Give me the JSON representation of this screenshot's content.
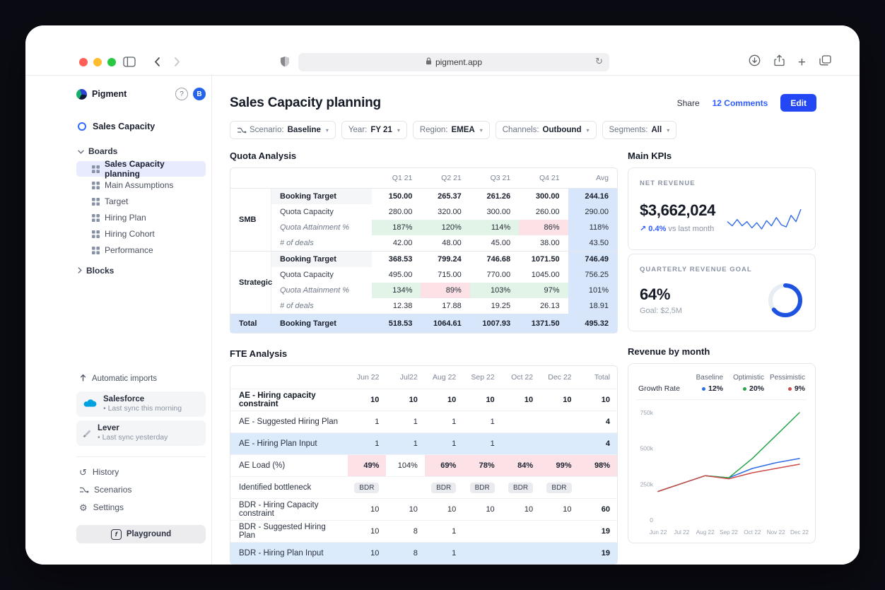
{
  "browser": {
    "address": "pigment.app"
  },
  "icons": {
    "back": "‹",
    "forward": "›",
    "reload": "↻",
    "new_tab": "+",
    "help": "?",
    "trend_up": "↗",
    "chevron_down": "▾",
    "history": "↺",
    "settings": "⚙",
    "bullet": "•",
    "playground": "f"
  },
  "theme": {
    "accent_blue": "#2447f5",
    "link_blue": "#2e5bff",
    "positive_cell": "#e2f3e7",
    "negative_cell": "#fce2e6",
    "avg_highlight": "#d8e6fb",
    "row_highlight": "#dcebfc",
    "selected_item_bg": "#e7ebfd",
    "sparkline_blue": "#2f6be6",
    "donut_blue": "#1d53e0"
  },
  "sidebar": {
    "app_name": "Pigment",
    "avatar_initial": "B",
    "workspace": {
      "label": "Sales Capacity"
    },
    "boards_section": "Boards",
    "boards": [
      {
        "label": "Sales Capacity planning",
        "selected": true
      },
      {
        "label": "Main Assumptions"
      },
      {
        "label": "Target"
      },
      {
        "label": "Hiring Plan"
      },
      {
        "label": "Hiring Cohort"
      },
      {
        "label": "Performance"
      }
    ],
    "blocks_section": "Blocks",
    "automatic_imports": "Automatic imports",
    "integrations": [
      {
        "name": "Salesforce",
        "status": "Last sync this morning",
        "icon": "salesforce-logo"
      },
      {
        "name": "Lever",
        "status": "Last sync yesterday",
        "icon": "lever-logo"
      }
    ],
    "menu": [
      {
        "label": "History",
        "icon": "history-icon"
      },
      {
        "label": "Scenarios",
        "icon": "scenario-icon"
      },
      {
        "label": "Settings",
        "icon": "settings-icon"
      }
    ],
    "playground_label": "Playground"
  },
  "header": {
    "title": "Sales Capacity planning",
    "share_label": "Share",
    "comments_label": "12 Comments",
    "edit_label": "Edit"
  },
  "filters": [
    {
      "label": "Scenario:",
      "value": "Baseline",
      "icon": "scenario"
    },
    {
      "label": "Year:",
      "value": "FY 21"
    },
    {
      "label": "Region:",
      "value": "EMEA"
    },
    {
      "label": "Channels:",
      "value": "Outbound"
    },
    {
      "label": "Segments:",
      "value": "All"
    }
  ],
  "quota_analysis": {
    "title": "Quota Analysis",
    "columns": [
      "Q1 21",
      "Q2 21",
      "Q3 21",
      "Q4 21",
      "Avg"
    ],
    "groups": [
      {
        "name": "SMB",
        "rows": [
          {
            "label": "Booking Target",
            "style": "bold",
            "cells": [
              {
                "v": "150.00"
              },
              {
                "v": "265.37"
              },
              {
                "v": "261.26"
              },
              {
                "v": "300.00"
              },
              {
                "v": "244.16",
                "bg": "blue"
              }
            ]
          },
          {
            "label": "Quota Capacity",
            "cells": [
              {
                "v": "280.00"
              },
              {
                "v": "320.00"
              },
              {
                "v": "300.00"
              },
              {
                "v": "260.00"
              },
              {
                "v": "290.00",
                "bg": "blue"
              }
            ]
          },
          {
            "label": "Quota Attainment %",
            "style": "italic",
            "cells": [
              {
                "v": "187%",
                "bg": "green"
              },
              {
                "v": "120%",
                "bg": "green"
              },
              {
                "v": "114%",
                "bg": "green"
              },
              {
                "v": "86%",
                "bg": "red"
              },
              {
                "v": "118%",
                "bg": "blue"
              }
            ]
          },
          {
            "label": "# of deals",
            "style": "italic",
            "cells": [
              {
                "v": "42.00"
              },
              {
                "v": "48.00"
              },
              {
                "v": "45.00"
              },
              {
                "v": "38.00"
              },
              {
                "v": "43.50",
                "bg": "blue"
              }
            ]
          }
        ]
      },
      {
        "name": "Strategic",
        "rows": [
          {
            "label": "Booking Target",
            "style": "bold",
            "cells": [
              {
                "v": "368.53"
              },
              {
                "v": "799.24"
              },
              {
                "v": "746.68"
              },
              {
                "v": "1071.50"
              },
              {
                "v": "746.49",
                "bg": "blue"
              }
            ]
          },
          {
            "label": "Quota Capacity",
            "cells": [
              {
                "v": "495.00"
              },
              {
                "v": "715.00"
              },
              {
                "v": "770.00"
              },
              {
                "v": "1045.00"
              },
              {
                "v": "756.25",
                "bg": "blue"
              }
            ]
          },
          {
            "label": "Quota Attainment %",
            "style": "italic",
            "cells": [
              {
                "v": "134%",
                "bg": "green"
              },
              {
                "v": "89%",
                "bg": "red"
              },
              {
                "v": "103%",
                "bg": "green"
              },
              {
                "v": "97%",
                "bg": "green"
              },
              {
                "v": "101%",
                "bg": "blue"
              }
            ]
          },
          {
            "label": "# of deals",
            "style": "italic",
            "cells": [
              {
                "v": "12.38"
              },
              {
                "v": "17.88"
              },
              {
                "v": "19.25"
              },
              {
                "v": "26.13"
              },
              {
                "v": "18.91",
                "bg": "blue"
              }
            ]
          }
        ]
      }
    ],
    "total_row": {
      "name": "Total",
      "label": "Booking Target",
      "cells": [
        {
          "v": "518.53"
        },
        {
          "v": "1064.61"
        },
        {
          "v": "1007.93"
        },
        {
          "v": "1371.50"
        },
        {
          "v": "495.32"
        }
      ]
    }
  },
  "main_kpis": {
    "title": "Main KPIs",
    "net_revenue": {
      "label": "NET REVENUE",
      "value": "$3,662,024",
      "delta": "0.4%",
      "delta_suffix": "vs last month",
      "sparkline": [
        34,
        30,
        36,
        30,
        34,
        28,
        33,
        27,
        35,
        30,
        38,
        31,
        29,
        40,
        34,
        46
      ]
    },
    "quarterly_goal": {
      "label": "QUARTERLY REVENUE GOAL",
      "value": "64%",
      "percent": 64,
      "goal": "Goal: $2,5M"
    }
  },
  "fte_analysis": {
    "title": "FTE Analysis",
    "columns": [
      "Jun 22",
      "Jul22",
      "Aug 22",
      "Sep 22",
      "Oct 22",
      "Dec 22",
      "Total"
    ],
    "rows": [
      {
        "label": "AE - Hiring capacity constraint",
        "style": "bold",
        "cells": [
          {
            "v": "10"
          },
          {
            "v": "10"
          },
          {
            "v": "10"
          },
          {
            "v": "10"
          },
          {
            "v": "10"
          },
          {
            "v": "10"
          },
          {
            "v": "10"
          }
        ]
      },
      {
        "label": "AE - Suggested Hiring Plan",
        "cells": [
          {
            "v": "1"
          },
          {
            "v": "1"
          },
          {
            "v": "1"
          },
          {
            "v": "1"
          },
          {
            "v": ""
          },
          {
            "v": ""
          },
          {
            "v": "4"
          }
        ]
      },
      {
        "label": "AE - Hiring Plan Input",
        "row_bg": "blue",
        "cells": [
          {
            "v": "1"
          },
          {
            "v": "1"
          },
          {
            "v": "1"
          },
          {
            "v": "1"
          },
          {
            "v": ""
          },
          {
            "v": ""
          },
          {
            "v": "4"
          }
        ]
      },
      {
        "label": "AE Load (%)",
        "cells": [
          {
            "v": "49%",
            "bg": "pink"
          },
          {
            "v": "104%"
          },
          {
            "v": "69%",
            "bg": "pink"
          },
          {
            "v": "78%",
            "bg": "pink"
          },
          {
            "v": "84%",
            "bg": "pink"
          },
          {
            "v": "99%",
            "bg": "pink"
          },
          {
            "v": "98%",
            "bg": "pink"
          }
        ]
      },
      {
        "label": "Identified bottleneck",
        "cells": [
          {
            "v": "BDR",
            "badge": true
          },
          {
            "v": ""
          },
          {
            "v": "BDR",
            "badge": true
          },
          {
            "v": "BDR",
            "badge": true
          },
          {
            "v": "BDR",
            "badge": true
          },
          {
            "v": "BDR",
            "badge": true
          },
          {
            "v": ""
          }
        ]
      },
      {
        "label": "BDR - Hiring Capacity constraint",
        "cells": [
          {
            "v": "10"
          },
          {
            "v": "10"
          },
          {
            "v": "10"
          },
          {
            "v": "10"
          },
          {
            "v": "10"
          },
          {
            "v": "10"
          },
          {
            "v": "60"
          }
        ]
      },
      {
        "label": "BDR - Suggested Hiring Plan",
        "cells": [
          {
            "v": "10"
          },
          {
            "v": "8"
          },
          {
            "v": "1"
          },
          {
            "v": ""
          },
          {
            "v": ""
          },
          {
            "v": ""
          },
          {
            "v": "19"
          }
        ]
      },
      {
        "label": "BDR - Hiring Plan Input",
        "row_bg": "blue",
        "cells": [
          {
            "v": "10"
          },
          {
            "v": "8"
          },
          {
            "v": "1"
          },
          {
            "v": ""
          },
          {
            "v": ""
          },
          {
            "v": ""
          },
          {
            "v": "19"
          }
        ]
      }
    ]
  },
  "revenue_chart": {
    "title": "Revenue by month",
    "legend_label": "Growth Rate",
    "chart_data": {
      "type": "line",
      "x": [
        "Jun 22",
        "Jul 22",
        "Aug 22",
        "Sep 22",
        "Oct 22",
        "Nov 22",
        "Dec 22"
      ],
      "ylim": [
        0,
        750000
      ],
      "ytick_values": [
        0,
        250000,
        500000,
        750000
      ],
      "ytick_labels": [
        "0",
        "250k",
        "500k",
        "750k"
      ],
      "grid": false,
      "legend_position": "top",
      "series": [
        {
          "name": "Baseline",
          "rate": "12%",
          "color": "#2e6be6",
          "values": [
            200000,
            255000,
            310000,
            295000,
            360000,
            400000,
            430000
          ]
        },
        {
          "name": "Optimistic",
          "rate": "20%",
          "color": "#27a349",
          "values": [
            200000,
            255000,
            310000,
            295000,
            430000,
            590000,
            750000
          ]
        },
        {
          "name": "Pessimistic",
          "rate": "9%",
          "color": "#cc4b4b",
          "values": [
            200000,
            255000,
            310000,
            288000,
            330000,
            360000,
            390000
          ]
        }
      ]
    }
  }
}
